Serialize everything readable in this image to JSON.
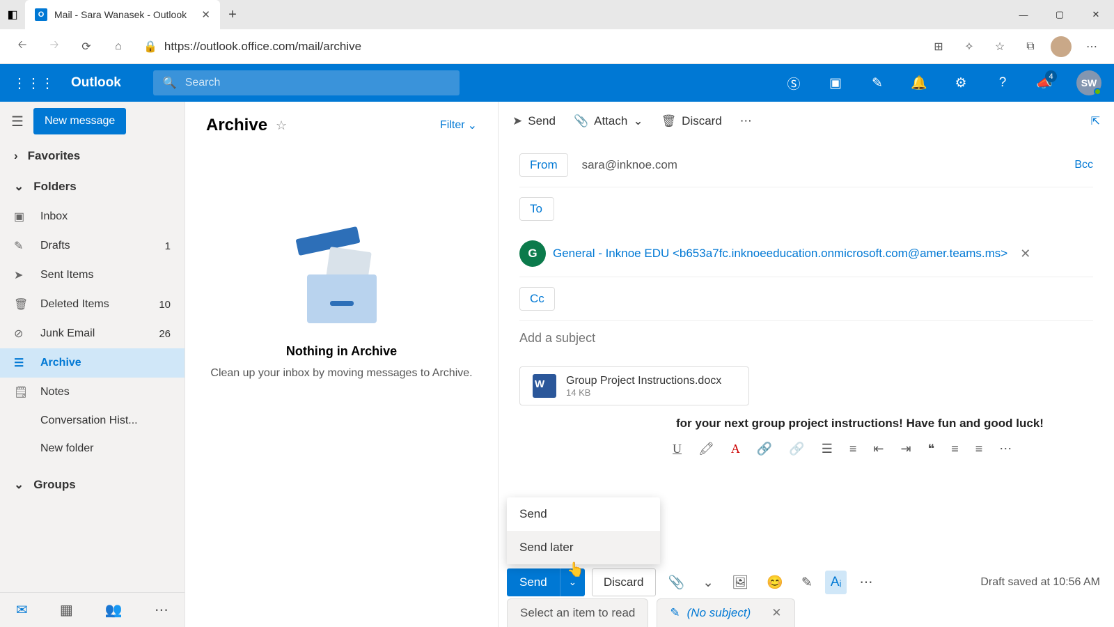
{
  "browser": {
    "tab_title": "Mail - Sara Wanasek - Outlook",
    "url": "https://outlook.office.com/mail/archive"
  },
  "suite": {
    "app_name": "Outlook",
    "search_placeholder": "Search",
    "notification_badge": "4",
    "user_initials": "SW"
  },
  "leftnav": {
    "new_message": "New message",
    "favorites": "Favorites",
    "folders_label": "Folders",
    "folders": {
      "inbox": "Inbox",
      "drafts": "Drafts",
      "drafts_count": "1",
      "sent": "Sent Items",
      "deleted": "Deleted Items",
      "deleted_count": "10",
      "junk": "Junk Email",
      "junk_count": "26",
      "archive": "Archive",
      "notes": "Notes",
      "conversation": "Conversation Hist...",
      "new_folder": "New folder"
    },
    "groups": "Groups"
  },
  "midcol": {
    "title": "Archive",
    "filter": "Filter",
    "empty_title": "Nothing in Archive",
    "empty_sub": "Clean up your inbox by moving messages to Archive."
  },
  "compose": {
    "toolbar": {
      "send": "Send",
      "attach": "Attach",
      "discard": "Discard"
    },
    "from_label": "From",
    "from_value": "sara@inknoe.com",
    "to_label": "To",
    "cc_label": "Cc",
    "bcc_label": "Bcc",
    "recipient": {
      "initial": "G",
      "text": "General - Inknoe EDU <b653a7fc.inknoeeducation.onmicrosoft.com@amer.teams.ms>"
    },
    "subject_placeholder": "Add a subject",
    "attachment": {
      "name": "Group Project Instructions.docx",
      "size": "14 KB"
    },
    "body_snippet": "for your next group project instructions! Have fun and good luck!",
    "send_menu": {
      "send": "Send",
      "send_later": "Send later"
    },
    "actions": {
      "send": "Send",
      "discard": "Discard"
    },
    "draft_status": "Draft saved at 10:56 AM"
  },
  "bottom_tabs": {
    "reading": "Select an item to read",
    "draft_subject": "(No subject)"
  }
}
